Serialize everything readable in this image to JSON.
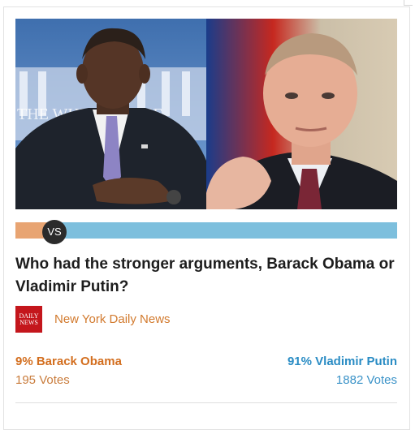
{
  "poll": {
    "vs_label": "VS",
    "question": "Who had the stronger arguments, Barack Obama or Vladimir Putin?",
    "source": {
      "logo_line1": "DAILY",
      "logo_line2": "NEWS",
      "name": "New York Daily News"
    },
    "left": {
      "title": "9% Barack Obama",
      "votes": "195 Votes",
      "percent": 9,
      "color": "#e8a472",
      "photo_text": "THE WHITE HOUSE"
    },
    "right": {
      "title": "91% Vladimir Putin",
      "votes": "1882 Votes",
      "percent": 91,
      "color": "#7dbfdd"
    }
  }
}
